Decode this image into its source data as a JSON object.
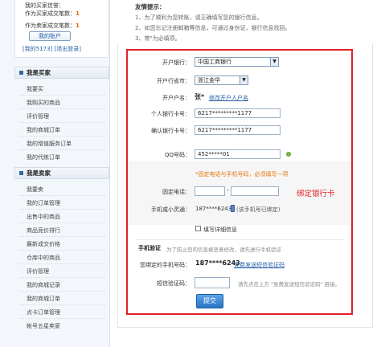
{
  "sidebar": {
    "user": {
      "line1_label": "我的买家信誉：",
      "line1_value": "",
      "line2_label": "作为买家成交笔数：",
      "line2_value": "1",
      "line3_label": "作为卖家成交笔数：",
      "line3_value": "1",
      "my_account_label": "我的账户",
      "links_text": "[我的5173] [退出登录]"
    },
    "buyer": {
      "title": "我是买家",
      "items": [
        "我要买",
        "我购买的商品",
        "评价管理",
        "我的商城订单",
        "我的增值服务订单",
        "我的代练订单"
      ]
    },
    "seller": {
      "title": "我是卖家",
      "items": [
        "我要卖",
        "我的订单管理",
        "出售中的商品",
        "商品竞价排行",
        "最新成交价格",
        "仓库中的商品",
        "评价管理",
        "我的商城记录",
        "我的商城订单",
        "点卡订单管理",
        "帐号五星卖家"
      ]
    }
  },
  "tips": {
    "title": "友情提示：",
    "lines": [
      "1、为了顺利为您转账，请正确填写您的银行信息。",
      "2、如您忘记注册邮箱等信息，可通过身份证，银行信息找回。",
      "3、带\"为必填项。"
    ]
  },
  "form": {
    "bank_label": "开户银行：",
    "bank_value": "中国工商银行",
    "city_label": "开户行省市：",
    "city_value": "浙江金华",
    "name_label": "开户户名：",
    "name_value": "张*",
    "edit_name_link": "修改开户人户名",
    "card_label": "个人银行卡号：",
    "card_value": "6217*********1177",
    "confirm_card_label": "确认银行卡号：",
    "confirm_card_value": "6217*********1177",
    "qq_label": "QQ号码：",
    "qq_value": "452*****01",
    "phone_note": "*固定电话与手机号码，必须填写一项",
    "landline_label": "固定电话：",
    "landline_sep": "-",
    "mobile_label": "手机或小灵通：",
    "mobile_value": "187****6243",
    "mobile_bound_note": "(该手机号已绑定)",
    "annotation": "绑定银行卡",
    "detail_check_label": "填写详细信息",
    "sms_title": "手机验证",
    "sms_desc": "为了防止您的信息被恶意修改，请先进行手机验证",
    "bound_mobile_label": "您绑定的手机号码：",
    "bound_mobile_value": "187****6243",
    "free_sms_link": "免费发送短信验证码",
    "sms_code_label": "短信验证码：",
    "sms_code_hint": "请先点击上方 \"免费发送短信验证码\" 链接。",
    "submit_label": "提交"
  }
}
